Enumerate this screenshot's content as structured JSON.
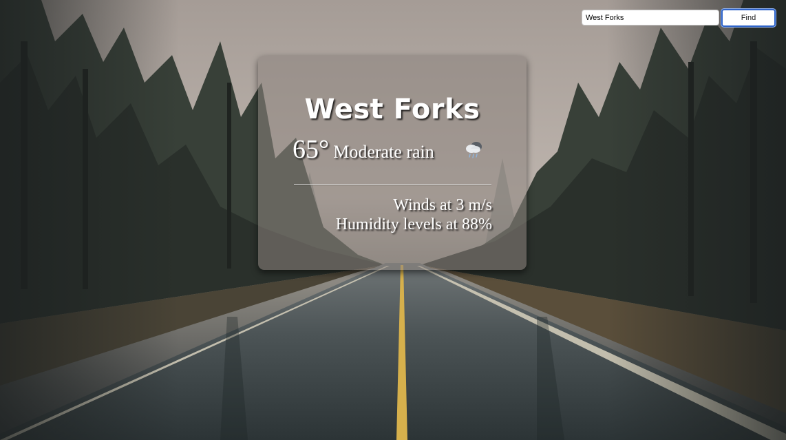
{
  "search": {
    "value": "West Forks",
    "button_label": "Find"
  },
  "weather": {
    "city": "West Forks",
    "temperature": "65°",
    "condition": "Moderate rain",
    "condition_icon": "rain-cloud-icon",
    "wind": "Winds at 3 m/s",
    "humidity": "Humidity levels at 88%"
  },
  "colors": {
    "card_background": "#8c847d",
    "button_border": "#2f64c9",
    "text": "#ffffff"
  }
}
